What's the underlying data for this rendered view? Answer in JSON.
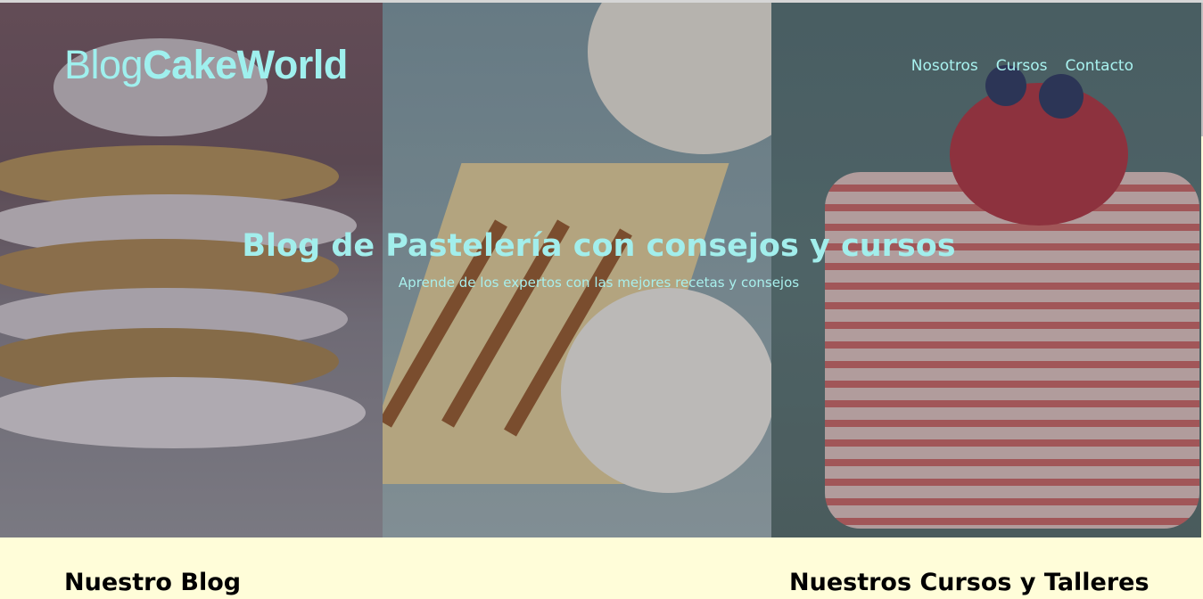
{
  "header": {
    "logo_part1": "Blog",
    "logo_part2": "CakeWorld",
    "nav": [
      "Nosotros",
      "Cursos",
      "Contacto"
    ]
  },
  "hero": {
    "title": "Blog de Pastelería con consejos y cursos",
    "subtitle": "Aprende de los expertos con las mejores recetas y consejos"
  },
  "sections": {
    "blog_title": "Nuestro Blog",
    "courses_title": "Nuestros Cursos y Talleres"
  },
  "colors": {
    "accent": "#a2eeec",
    "page_bg": "#fffdd9"
  }
}
